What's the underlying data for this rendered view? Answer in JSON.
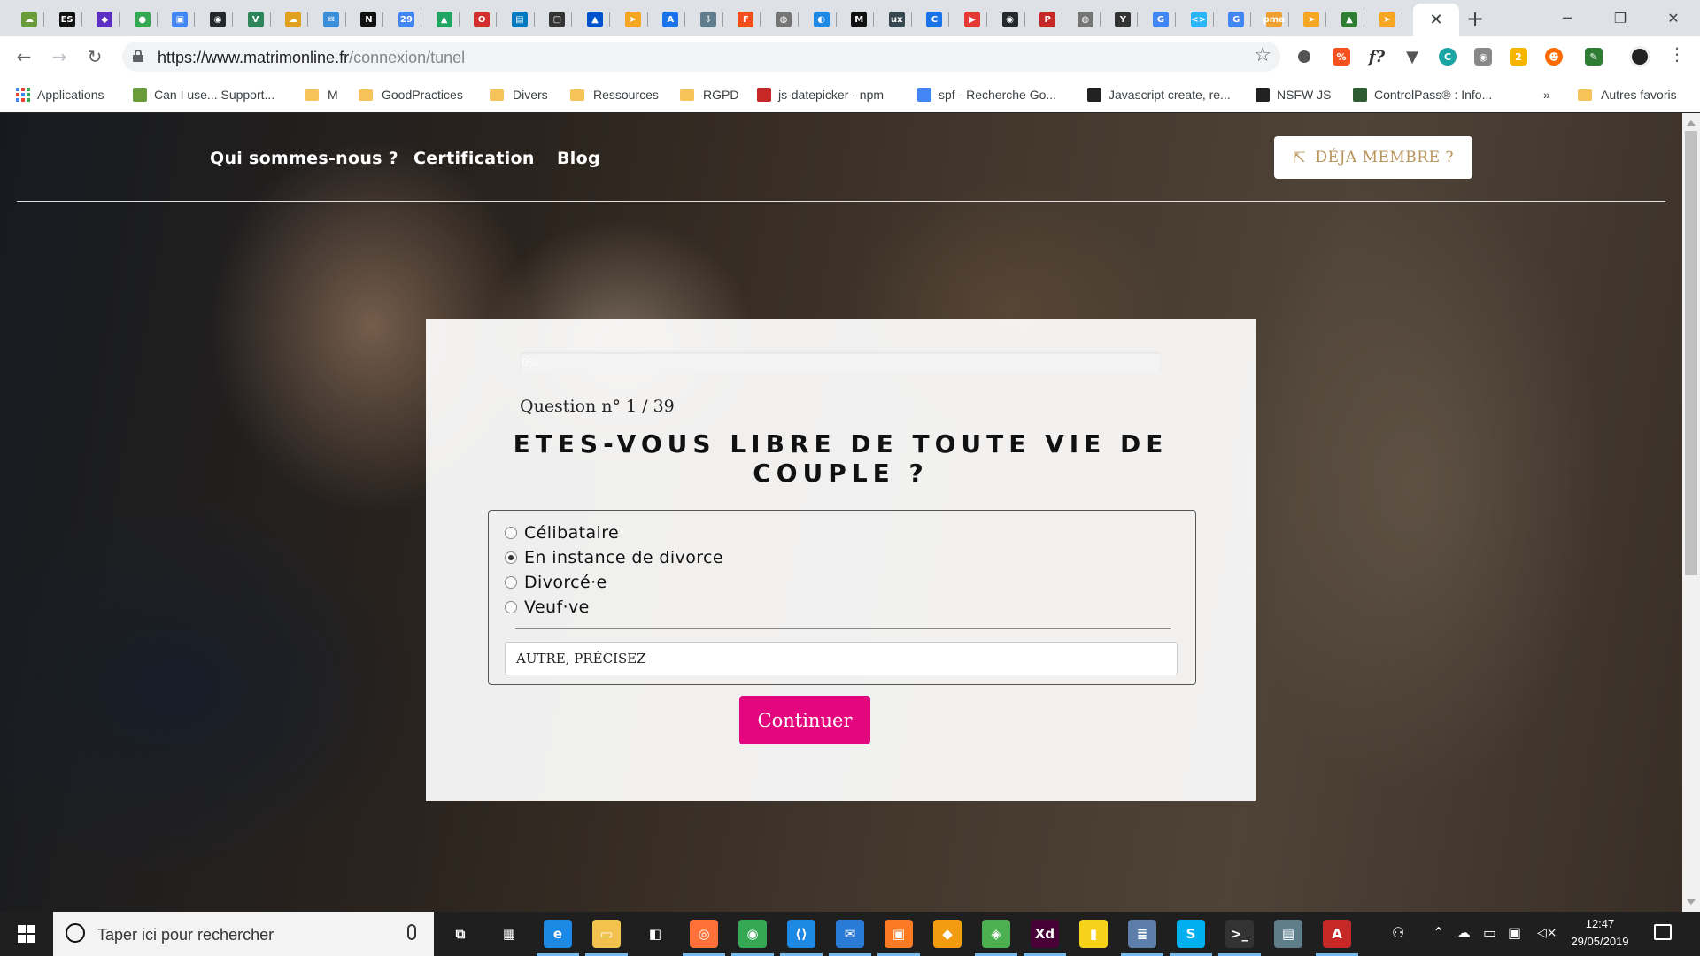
{
  "browser": {
    "tabs": [
      {
        "icon": "weather-icon",
        "color": "#6a9b3a",
        "glyph": "☁"
      },
      {
        "icon": "es-icon",
        "color": "#111111",
        "glyph": "ES"
      },
      {
        "icon": "cube-icon",
        "color": "#5b2fc2",
        "glyph": "◆"
      },
      {
        "icon": "map-pin-icon",
        "color": "#34a853",
        "glyph": "●"
      },
      {
        "icon": "video-icon",
        "color": "#4285f4",
        "glyph": "▣"
      },
      {
        "icon": "github-icon",
        "color": "#24292e",
        "glyph": "◉"
      },
      {
        "icon": "vue-icon",
        "color": "#2f855a",
        "glyph": "V"
      },
      {
        "icon": "cloud-icon",
        "color": "#e0a020",
        "glyph": "☁"
      },
      {
        "icon": "chat-icon",
        "color": "#3a8fd8",
        "glyph": "✉"
      },
      {
        "icon": "notion-icon",
        "color": "#111111",
        "glyph": "N"
      },
      {
        "icon": "calendar-icon",
        "color": "#4285f4",
        "glyph": "29"
      },
      {
        "icon": "drive-icon",
        "color": "#1fa463",
        "glyph": "▲"
      },
      {
        "icon": "opera-icon",
        "color": "#d32f2f",
        "glyph": "O"
      },
      {
        "icon": "trello-icon",
        "color": "#0079bf",
        "glyph": "▤"
      },
      {
        "icon": "square-icon",
        "color": "#333333",
        "glyph": "▢"
      },
      {
        "icon": "atlassian-icon",
        "color": "#0052cc",
        "glyph": "▲"
      },
      {
        "icon": "arrow-icon",
        "color": "#f5a623",
        "glyph": "➤"
      },
      {
        "icon": "appstore-icon",
        "color": "#1a73e8",
        "glyph": "A"
      },
      {
        "icon": "download-icon",
        "color": "#607d8b",
        "glyph": "⇩"
      },
      {
        "icon": "figma-icon",
        "color": "#f24e1e",
        "glyph": "F"
      },
      {
        "icon": "globe-icon",
        "color": "#757575",
        "glyph": "◍"
      },
      {
        "icon": "drop-icon",
        "color": "#1e88e5",
        "glyph": "◐"
      },
      {
        "icon": "medium-icon",
        "color": "#111111",
        "glyph": "M"
      },
      {
        "icon": "ux-icon",
        "color": "#37474f",
        "glyph": "ux"
      },
      {
        "icon": "c-icon",
        "color": "#1a73e8",
        "glyph": "C"
      },
      {
        "icon": "youtube-icon",
        "color": "#e53935",
        "glyph": "▶"
      },
      {
        "icon": "github-icon",
        "color": "#24292e",
        "glyph": "◉"
      },
      {
        "icon": "pdf-icon",
        "color": "#c62828",
        "glyph": "P"
      },
      {
        "icon": "globe-icon",
        "color": "#757575",
        "glyph": "◍"
      },
      {
        "icon": "yahoo-icon",
        "color": "#333333",
        "glyph": "Y"
      },
      {
        "icon": "google-icon",
        "color": "#4285f4",
        "glyph": "G"
      },
      {
        "icon": "code-icon",
        "color": "#29b6f6",
        "glyph": "<>"
      },
      {
        "icon": "google-icon",
        "color": "#4285f4",
        "glyph": "G"
      },
      {
        "icon": "pma-icon",
        "color": "#f0a030",
        "glyph": "pma"
      },
      {
        "icon": "arrow-icon",
        "color": "#f5a623",
        "glyph": "➤"
      },
      {
        "icon": "mountain-icon",
        "color": "#2e7d32",
        "glyph": "▲"
      },
      {
        "icon": "arrow-icon",
        "color": "#f5a623",
        "glyph": "➤"
      }
    ],
    "active_tab_close": "✕",
    "new_tab": "+",
    "window_controls": {
      "minimize": "─",
      "restore": "❐",
      "close": "✕"
    },
    "url_host": "https://www.matrimonline.fr",
    "url_path": "/connexion/tunel",
    "bookmarks": [
      {
        "label": "Applications",
        "type": "apps"
      },
      {
        "label": "Can I use... Support...",
        "type": "site",
        "color": "#6a9b3a"
      },
      {
        "label": "M",
        "type": "folder"
      },
      {
        "label": "GoodPractices",
        "type": "folder"
      },
      {
        "label": "Divers",
        "type": "folder"
      },
      {
        "label": "Ressources",
        "type": "folder"
      },
      {
        "label": "RGPD",
        "type": "folder"
      },
      {
        "label": "js-datepicker - npm",
        "type": "site",
        "color": "#c62828"
      },
      {
        "label": "spf - Recherche Go...",
        "type": "site",
        "color": "#4285f4"
      },
      {
        "label": "Javascript create, re...",
        "type": "site",
        "color": "#222222"
      },
      {
        "label": "NSFW JS",
        "type": "site",
        "color": "#222222"
      },
      {
        "label": "ControlPass® : Info...",
        "type": "site",
        "color": "#2e5d34"
      }
    ],
    "bookmarks_more": "»",
    "other_bookmarks": "Autres favoris"
  },
  "site": {
    "nav": [
      "Qui sommes-nous ?",
      "Certification",
      "Blog"
    ],
    "member_button": "DÉJA MEMBRE ?"
  },
  "quiz": {
    "progress_label": "0%",
    "progress_value": 0,
    "question_number": "Question n° 1 / 39",
    "question": "ETES-VOUS LIBRE DE TOUTE VIE DE COUPLE ?",
    "options": [
      {
        "label": "Célibataire",
        "checked": false
      },
      {
        "label": "En instance de divorce",
        "checked": true
      },
      {
        "label": "Divorcé·e",
        "checked": false
      },
      {
        "label": "Veuf·ve",
        "checked": false
      }
    ],
    "other_placeholder": "AUTRE, PRÉCISEZ",
    "continue_label": "Continuer",
    "accent_color": "#e4067f"
  },
  "taskbar": {
    "search_placeholder": "Taper ici pour rechercher",
    "apps": [
      {
        "name": "task-view-icon",
        "glyph": "⧉",
        "color": "transparent"
      },
      {
        "name": "calculator-icon",
        "glyph": "▦",
        "color": "transparent"
      },
      {
        "name": "edge-icon",
        "glyph": "e",
        "color": "#1e88e5"
      },
      {
        "name": "file-explorer-icon",
        "glyph": "▭",
        "color": "#f2c14e"
      },
      {
        "name": "store-icon",
        "glyph": "◧",
        "color": "transparent"
      },
      {
        "name": "firefox-icon",
        "glyph": "◎",
        "color": "#ff7139"
      },
      {
        "name": "chrome-icon",
        "glyph": "◉",
        "color": "#34a853"
      },
      {
        "name": "vscode-icon",
        "glyph": "⟨⟩",
        "color": "#1e88e5"
      },
      {
        "name": "thunderbird-icon",
        "glyph": "✉",
        "color": "#2a7bd8"
      },
      {
        "name": "xampp-icon",
        "glyph": "▣",
        "color": "#fb7a24"
      },
      {
        "name": "fish-icon",
        "glyph": "◆",
        "color": "#f39c12"
      },
      {
        "name": "git-icon",
        "glyph": "◈",
        "color": "#4caf50"
      },
      {
        "name": "xd-icon",
        "glyph": "Xd",
        "color": "#470137"
      },
      {
        "name": "sticky-notes-icon",
        "glyph": "▮",
        "color": "#f7d21b"
      },
      {
        "name": "notepad-icon",
        "glyph": "≣",
        "color": "#5c7ea8"
      },
      {
        "name": "skype-icon",
        "glyph": "S",
        "color": "#00aff0"
      },
      {
        "name": "terminal-icon",
        "glyph": ">_",
        "color": "#333333"
      },
      {
        "name": "remote-icon",
        "glyph": "▤",
        "color": "#607d8b"
      },
      {
        "name": "acrobat-icon",
        "glyph": "A",
        "color": "#c62828"
      }
    ],
    "time": "12:47",
    "date": "29/05/2019"
  }
}
